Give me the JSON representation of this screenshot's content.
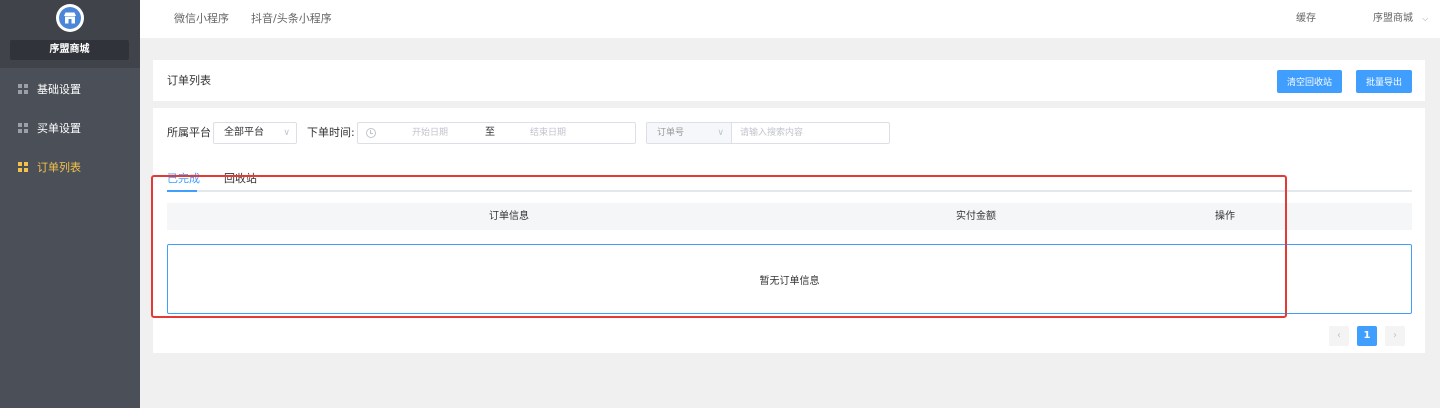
{
  "sidebar": {
    "store_name": "序盟商城",
    "items": [
      {
        "label": "基础设置"
      },
      {
        "label": "买单设置"
      },
      {
        "label": "订单列表"
      }
    ]
  },
  "topbar": {
    "nav": [
      "微信小程序",
      "抖音/头条小程序"
    ],
    "cache": "缓存",
    "user": "序盟商城"
  },
  "header": {
    "title": "订单列表",
    "clear_recycle_label": "清空回收站",
    "batch_export_label": "批量导出"
  },
  "filters": {
    "platform_label": "所属平台",
    "platform_value": "全部平台",
    "time_label": "下单时间:",
    "start_placeholder": "开始日期",
    "range_separator": "至",
    "end_placeholder": "结束日期",
    "search_type": "订单号",
    "search_placeholder": "请输入搜索内容"
  },
  "tabs": [
    {
      "label": "已完成",
      "active": true
    },
    {
      "label": "回收站",
      "active": false
    }
  ],
  "table": {
    "columns": [
      "订单信息",
      "实付金额",
      "操作"
    ],
    "empty_text": "暂无订单信息"
  },
  "pagination": {
    "prev": "‹",
    "current": "1",
    "next": "›"
  },
  "colors": {
    "primary": "#409eff",
    "sidebar_bg": "#4b5058",
    "active_nav": "#f4c24a",
    "highlight": "#e53935"
  }
}
